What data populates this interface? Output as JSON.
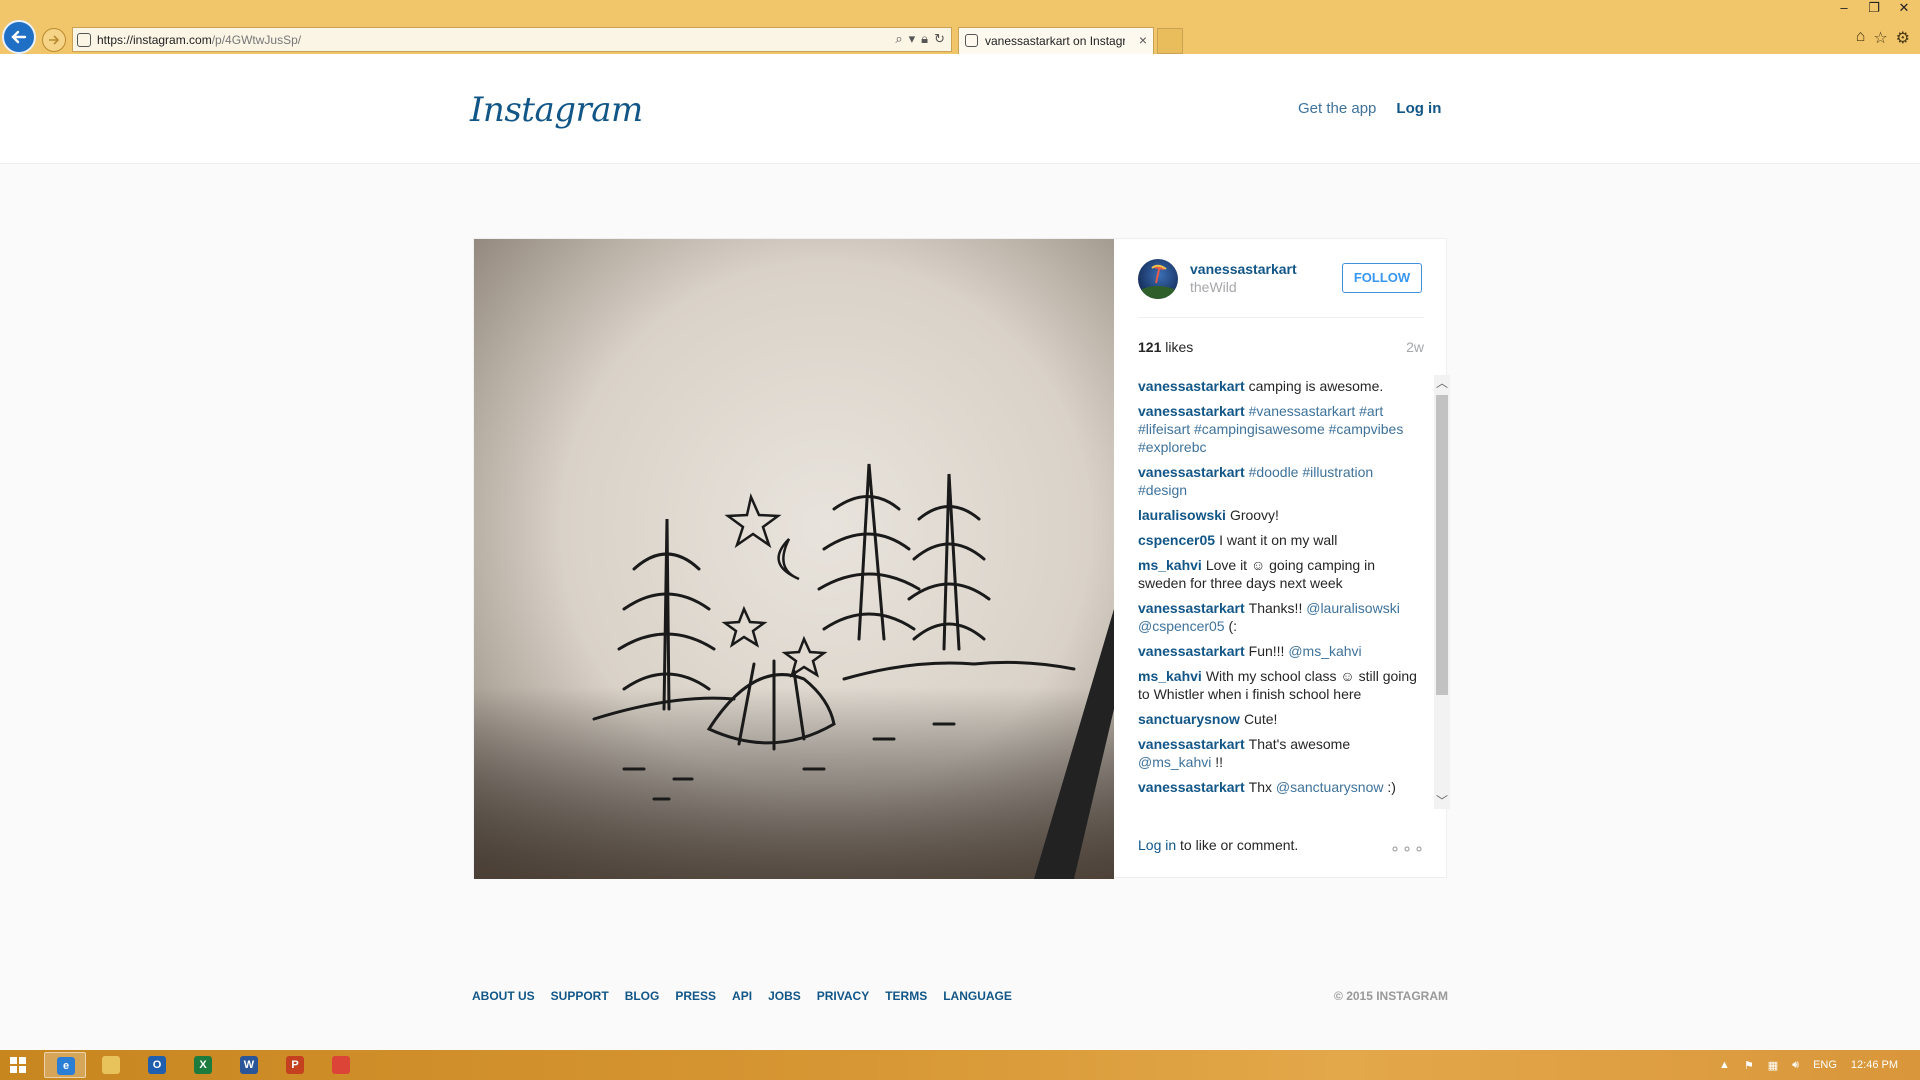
{
  "browser": {
    "url_host": "https://instagram.com",
    "url_path": "/p/4GWtwJusSp/",
    "tab_title": "vanessastarkart on Instagra...",
    "tab_close": "×"
  },
  "header": {
    "logo": "Instagram",
    "get_app": "Get the app",
    "login": "Log in"
  },
  "post": {
    "username": "vanessastarkart",
    "location": "theWild",
    "follow_label": "FOLLOW",
    "likes_count": "121",
    "likes_label": "likes",
    "time_ago": "2w",
    "comments": [
      {
        "user": "vanessastarkart",
        "text": "camping is awesome.",
        "tags": ""
      },
      {
        "user": "vanessastarkart",
        "text": "",
        "tags": "#vanessastarkart #art #lifeisart #campingisawesome #campvibes #explorebc"
      },
      {
        "user": "vanessastarkart",
        "text": "",
        "tags": "#doodle #illustration #design"
      },
      {
        "user": "lauralisowski",
        "text": "Groovy!",
        "tags": ""
      },
      {
        "user": "cspencer05",
        "text": "I want it on my wall",
        "tags": ""
      },
      {
        "user": "ms_kahvi",
        "text": "Love it ☺ going camping in sweden for three days next week",
        "tags": ""
      },
      {
        "user": "vanessastarkart",
        "text": "Thanks!! ",
        "tags": "@lauralisowski @cspencer05",
        "after": " (:"
      },
      {
        "user": "vanessastarkart",
        "text": "Fun!!! ",
        "tags": "@ms_kahvi"
      },
      {
        "user": "ms_kahvi",
        "text": "With my school class ☺ still going to Whistler when i finish school here",
        "tags": ""
      },
      {
        "user": "sanctuarysnow",
        "text": "Cute!",
        "tags": ""
      },
      {
        "user": "vanessastarkart",
        "text": "That's awesome ",
        "tags": "@ms_kahvi",
        "after": " !!"
      },
      {
        "user": "vanessastarkart",
        "text": "Thx ",
        "tags": "@sanctuarysnow",
        "after": " :)"
      }
    ],
    "login_link": "Log in",
    "login_suffix": " to like or comment.",
    "more_icon": "ellipsis-icon"
  },
  "footer": {
    "links": [
      "ABOUT US",
      "SUPPORT",
      "BLOG",
      "PRESS",
      "API",
      "JOBS",
      "PRIVACY",
      "TERMS",
      "LANGUAGE"
    ],
    "copyright": "© 2015 INSTAGRAM"
  },
  "taskbar": {
    "apps": [
      {
        "name": "internet-explorer",
        "glyph": "e",
        "color": "#2a7fd4"
      },
      {
        "name": "file-explorer",
        "glyph": "",
        "color": "#e8c25a"
      },
      {
        "name": "outlook",
        "glyph": "O",
        "color": "#1f5fae"
      },
      {
        "name": "excel",
        "glyph": "X",
        "color": "#1e7b3e"
      },
      {
        "name": "word",
        "glyph": "W",
        "color": "#2a5699"
      },
      {
        "name": "powerpoint",
        "glyph": "P",
        "color": "#c5401f"
      },
      {
        "name": "chrome",
        "glyph": "",
        "color": "#db4437"
      }
    ],
    "language": "ENG",
    "clock": "12:46 PM"
  },
  "colors": {
    "chrome_bg": "#f1c66a",
    "link_blue": "#125688",
    "accent_blue": "#3897f0"
  }
}
